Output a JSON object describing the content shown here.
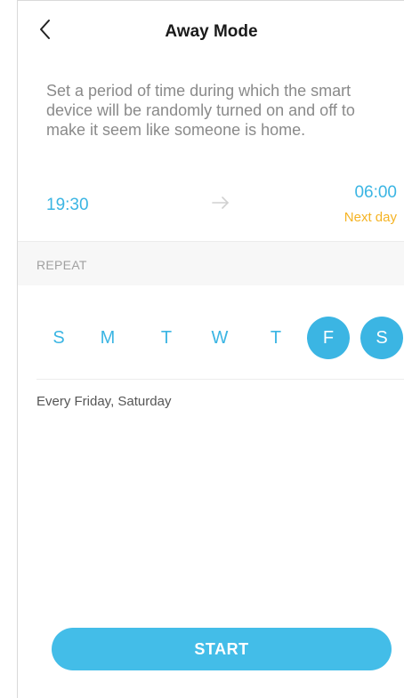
{
  "header": {
    "title": "Away Mode",
    "back_icon": "chevron-left-icon"
  },
  "description": "Set a period of time during which the smart device will be randomly turned on and off to make it seem like someone is home.",
  "schedule": {
    "start_time": "19:30",
    "arrow_icon": "arrow-right-icon",
    "end_time": "06:00",
    "end_note": "Next day"
  },
  "repeat": {
    "label": "REPEAT",
    "days": [
      {
        "label": "S",
        "selected": false
      },
      {
        "label": "M",
        "selected": false
      },
      {
        "label": "T",
        "selected": false
      },
      {
        "label": "W",
        "selected": false
      },
      {
        "label": "T",
        "selected": false
      },
      {
        "label": "F",
        "selected": true
      },
      {
        "label": "S",
        "selected": true
      }
    ],
    "summary": "Every Friday, Saturday"
  },
  "actions": {
    "start_label": "START"
  },
  "colors": {
    "accent": "#3bb5e3",
    "button": "#43bde8",
    "warning": "#f5b323",
    "muted_text": "#8a8a8a"
  }
}
